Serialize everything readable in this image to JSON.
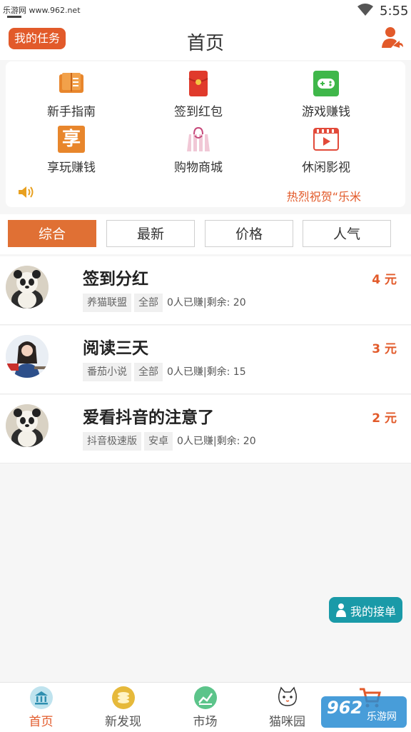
{
  "status_bar": {
    "watermark_text": "乐游网 www.962.net",
    "time": "5:55"
  },
  "header": {
    "my_tasks_button": "我的任务",
    "title": "首页"
  },
  "grid": [
    {
      "label": "新手指南",
      "icon": "book-icon"
    },
    {
      "label": "签到红包",
      "icon": "red-envelope-icon"
    },
    {
      "label": "游戏赚钱",
      "icon": "gamepad-icon"
    },
    {
      "label": "享玩赚钱",
      "icon": "xiang-icon",
      "icon_char": "享"
    },
    {
      "label": "购物商城",
      "icon": "shopping-bag-icon"
    },
    {
      "label": "休闲影视",
      "icon": "film-icon"
    }
  ],
  "announcement": "热烈祝贺“乐米",
  "tabs": [
    "综合",
    "最新",
    "价格",
    "人气"
  ],
  "tasks": [
    {
      "title": "签到分红",
      "price": "4 元",
      "tags": [
        "养猫联盟",
        "全部"
      ],
      "meta": "0人已赚|剩余: 20",
      "avatar": "panda-avatar"
    },
    {
      "title": "阅读三天",
      "price": "3 元",
      "tags": [
        "番茄小说",
        "全部"
      ],
      "meta": "0人已赚|剩余: 15",
      "avatar": "woman-avatar"
    },
    {
      "title": "爱看抖音的注意了",
      "price": "2 元",
      "tags": [
        "抖音极速版",
        "安卓"
      ],
      "meta": "0人已赚|剩余: 20",
      "avatar": "panda-avatar"
    }
  ],
  "floating_button": "我的接单",
  "bottom_nav": [
    {
      "label": "首页",
      "icon": "bank-icon",
      "active": true
    },
    {
      "label": "新发现",
      "icon": "coins-icon",
      "active": false
    },
    {
      "label": "市场",
      "icon": "chart-icon",
      "active": false
    },
    {
      "label": "猫咪园",
      "icon": "cat-icon",
      "active": false
    },
    {
      "label": "",
      "icon": "cart-icon",
      "active": false
    }
  ],
  "watermark": {
    "big": "962",
    "small": "乐游网"
  },
  "colors": {
    "accent": "#e25a2a",
    "tab_active": "#e07034",
    "float_button": "#1a9aa8"
  }
}
